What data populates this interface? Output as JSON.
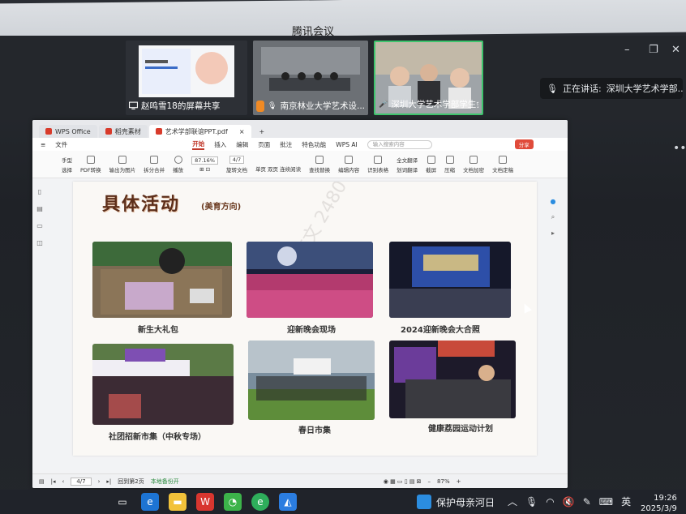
{
  "meeting": {
    "title": "腾讯会议",
    "participants": [
      {
        "name": "赵鸣雪18的屏幕共享",
        "state": "sharing"
      },
      {
        "name": "南京林业大学艺术设...",
        "state": "muted"
      },
      {
        "name": "深圳大学艺术学部学生会...",
        "state": "active-speaker"
      }
    ],
    "speaking_label": "正在讲话:",
    "speaking_name": "深圳大学艺术学部...",
    "window_controls": [
      "–",
      "❐",
      "✕"
    ]
  },
  "wps": {
    "tabs": [
      "WPS Office",
      "稻壳素材",
      "艺术学部联谊PPT.pdf"
    ],
    "file_menu": "文件",
    "menus": [
      "开始",
      "插入",
      "编辑",
      "页面",
      "批注",
      "特色功能",
      "WPS AI"
    ],
    "active_menu": "开始",
    "search_placeholder": "输入搜索内容",
    "share_label": "分享",
    "toolbar": {
      "hand": "手型",
      "select": "选择",
      "pdf_convert": "PDF转换",
      "export_image": "输出为图片",
      "split_merge": "拆分合并",
      "play": "播放",
      "zoom": "87.16%",
      "page_box": "4/7",
      "rotate": "旋转文档",
      "single_page": "单页",
      "double_page": "双页",
      "continuous": "连续阅读",
      "find_replace": "查找替换",
      "edit_content": "编辑内容",
      "recognize_table": "识别表格",
      "full_translate": "全文翻译",
      "word_translate": "划词翻译",
      "screenshot": "截屏",
      "compress": "压缩",
      "encrypt": "文档加密",
      "sign": "文档定稿"
    },
    "status": {
      "page": "4/7",
      "hint": "回到第2页",
      "backup": "本地备份开",
      "zoom": "87%"
    }
  },
  "slide": {
    "title": "具体活动",
    "subtitle": "(美育方向)",
    "watermark": "志文 2480",
    "items": [
      {
        "caption": "新生大礼包"
      },
      {
        "caption": "迎新晚会现场"
      },
      {
        "caption": "2024迎新晚会大合照"
      },
      {
        "caption": "社团招新市集（中秋专场）"
      },
      {
        "caption": "春日市集"
      },
      {
        "caption": "健康荔园运动计划"
      }
    ]
  },
  "taskbar": {
    "news_text": "保护母亲河日",
    "ime": "英",
    "time": "19:26",
    "date": "2025/3/9"
  }
}
